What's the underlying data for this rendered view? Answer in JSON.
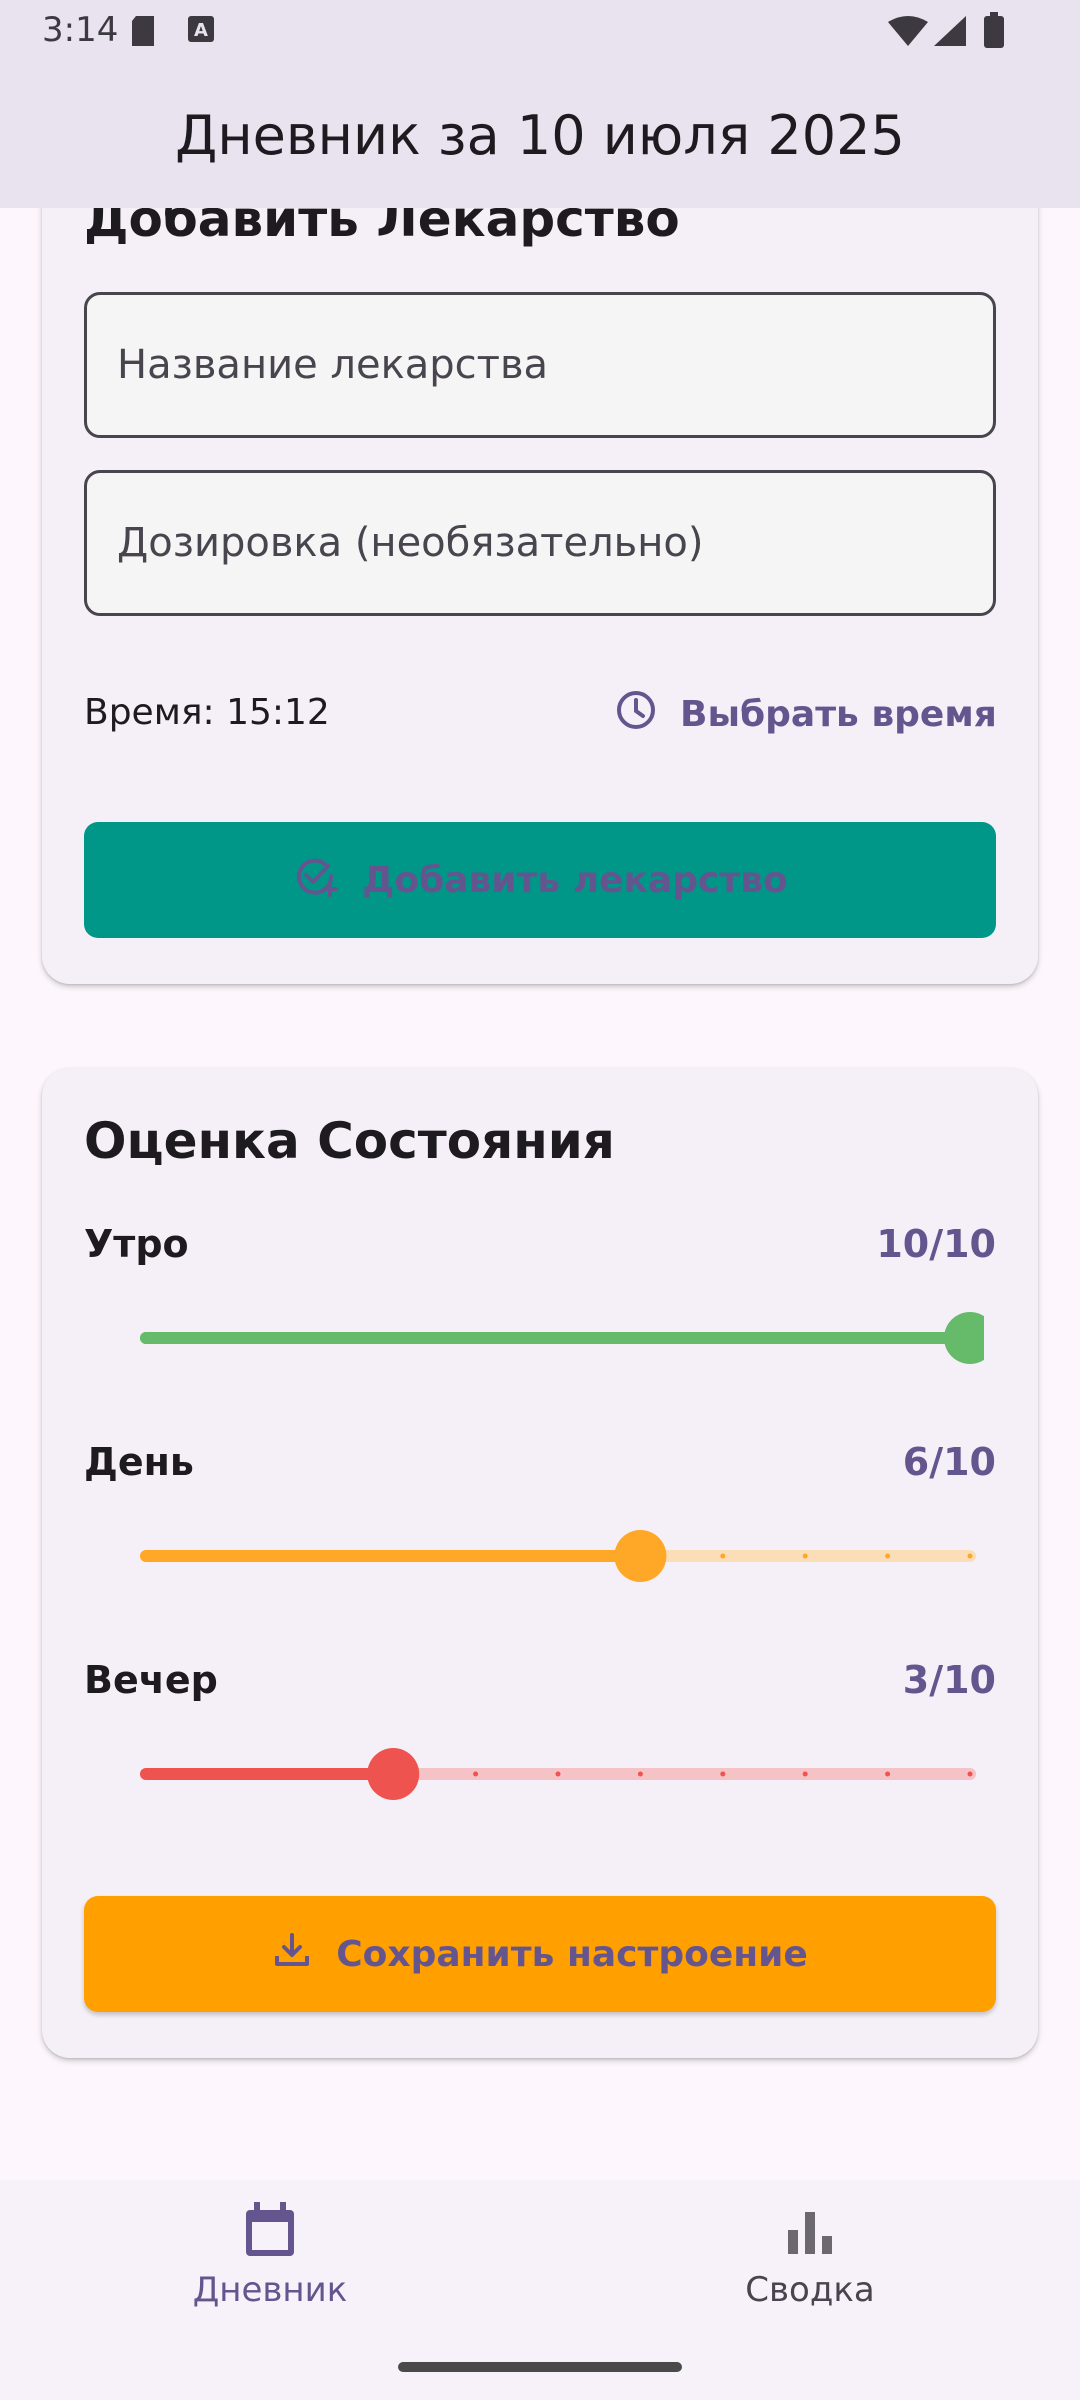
{
  "status_bar": {
    "time": "3:14"
  },
  "top_bar": {
    "title": "Дневник за 10 июля 2025"
  },
  "medicine_card": {
    "title": "Добавить Лекарство",
    "name_placeholder": "Название лекарства",
    "dosage_placeholder": "Дозировка (необязательно)",
    "time_label": "Время: 15:12",
    "pick_time_label": "Выбрать время",
    "add_button_label": "Добавить лекарство"
  },
  "mood_card": {
    "title": "Оценка Состояния",
    "morning": {
      "label": "Утро",
      "value_text": "10/10",
      "value": 10,
      "max": 10,
      "color": "#66bb6a",
      "track_color": "#66bb6a"
    },
    "day": {
      "label": "День",
      "value_text": "6/10",
      "value": 6,
      "max": 10,
      "color": "#ffa726",
      "track_color": "#fbddb8"
    },
    "evening": {
      "label": "Вечер",
      "value_text": "3/10",
      "value": 3,
      "max": 10,
      "color": "#ef5350",
      "track_color": "#f5c2c5"
    },
    "save_button_label": "Сохранить настроение"
  },
  "bottom_nav": {
    "items": [
      {
        "label": "Дневник",
        "icon": "calendar-icon",
        "active": true
      },
      {
        "label": "Сводка",
        "icon": "bar-chart-icon",
        "active": false
      }
    ]
  },
  "colors": {
    "accent": "#65558f",
    "teal": "#009688",
    "orange": "#ffa000",
    "appbar": "#e8e3ef"
  }
}
